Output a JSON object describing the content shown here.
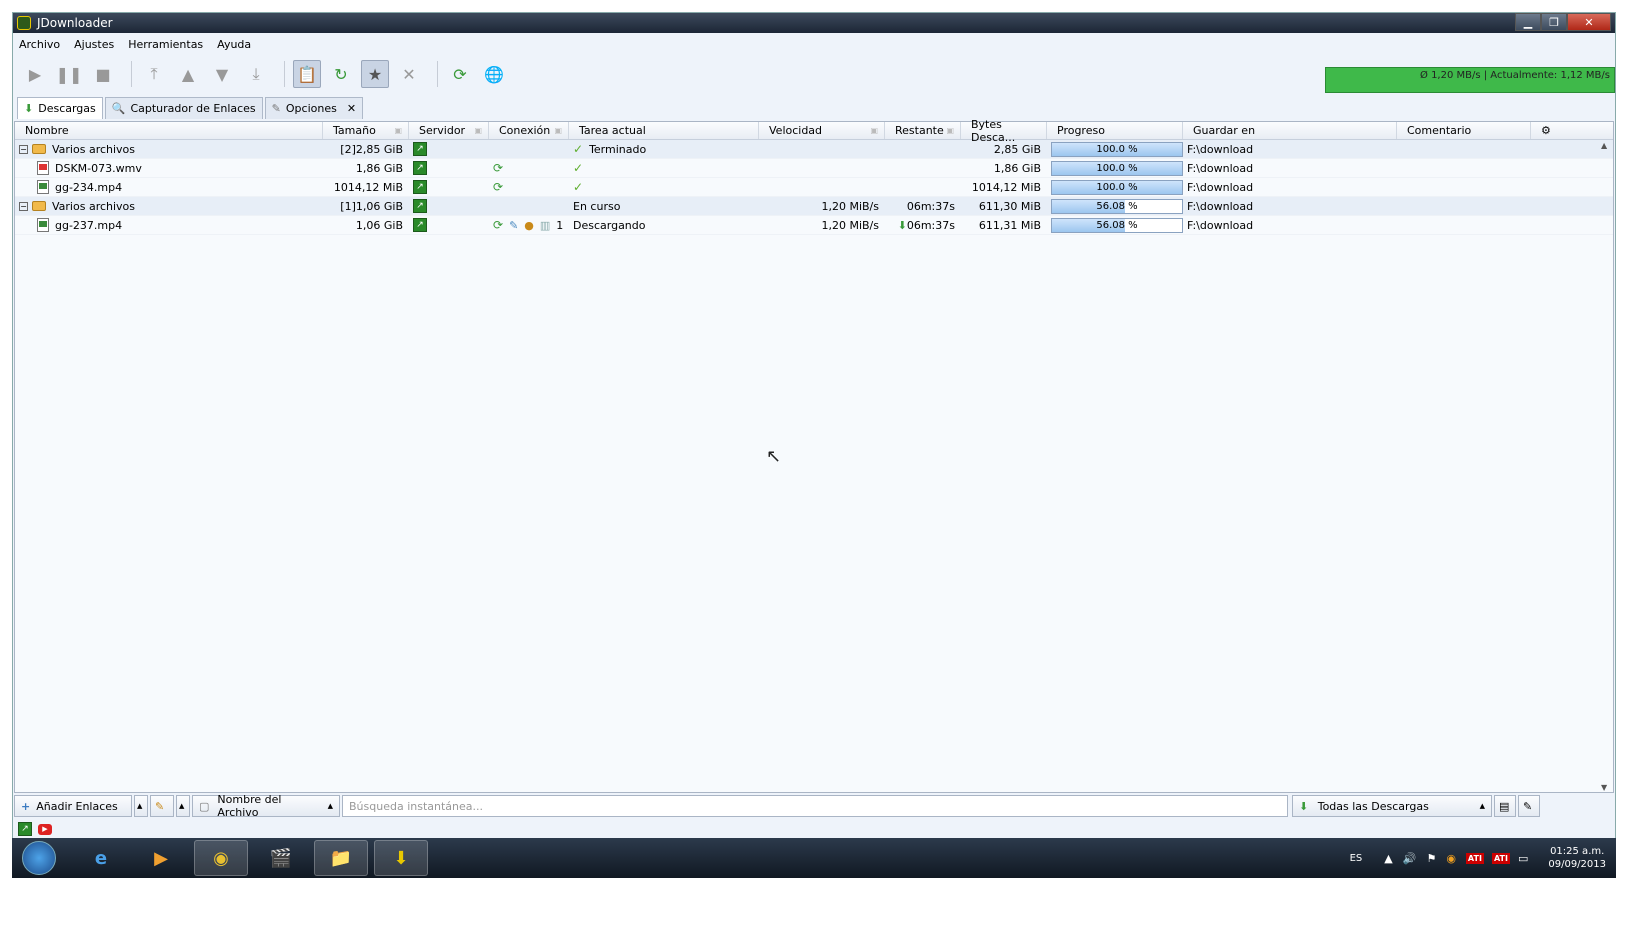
{
  "window": {
    "title": "JDownloader"
  },
  "menu": [
    "Archivo",
    "Ajustes",
    "Herramientas",
    "Ayuda"
  ],
  "speed": {
    "text": "Ø 1,20 MB/s | Actualmente: 1,12 MB/s"
  },
  "tabs": [
    {
      "label": "Descargas",
      "active": true
    },
    {
      "label": "Capturador de Enlaces",
      "active": false
    },
    {
      "label": "Opciones",
      "active": false
    }
  ],
  "columns": [
    "Nombre",
    "Tamaño",
    "Servidor",
    "Conexión",
    "Tarea actual",
    "Velocidad",
    "Restante",
    "Bytes Desca...",
    "Progreso",
    "Guardar en",
    "Comentario"
  ],
  "rows": [
    {
      "type": "package",
      "expander": "−",
      "name": "Varios archivos",
      "count": "[2]",
      "size": "2,85 GiB",
      "task": "Terminado",
      "task_icon": "check",
      "speed": "",
      "remaining": "",
      "bytes": "2,85 GiB",
      "progress": 100.0,
      "progress_text": "100.0 %",
      "save": "F:\\download"
    },
    {
      "type": "file",
      "ext": "wmv",
      "name": "DSKM-073.wmv",
      "size": "1,86 GiB",
      "conn": true,
      "task": "",
      "task_icon": "check",
      "speed": "",
      "remaining": "",
      "bytes": "1,86 GiB",
      "progress": 100.0,
      "progress_text": "100.0 %",
      "save": "F:\\download"
    },
    {
      "type": "file",
      "ext": "mp4",
      "name": "gg-234.mp4",
      "size": "1014,12 MiB",
      "conn": true,
      "task": "",
      "task_icon": "check",
      "speed": "",
      "remaining": "",
      "bytes": "1014,12 MiB",
      "progress": 100.0,
      "progress_text": "100.0 %",
      "save": "F:\\download"
    },
    {
      "type": "package",
      "expander": "−",
      "name": "Varios archivos",
      "count": "[1]",
      "size": "1,06 GiB",
      "task": "En curso",
      "task_icon": "",
      "speed": "1,20 MiB/s",
      "remaining": "06m:37s",
      "bytes": "611,30 MiB",
      "progress": 56.08,
      "progress_text": "56.08 %",
      "save": "F:\\download"
    },
    {
      "type": "file",
      "ext": "mp4",
      "name": "gg-237.mp4",
      "size": "1,06 GiB",
      "conn": true,
      "conn_count": "1",
      "task": "Descargando",
      "task_icon": "",
      "speed": "1,20 MiB/s",
      "remaining": "06m:37s",
      "bytes": "611,31 MiB",
      "progress": 56.08,
      "progress_text": "56.08 %",
      "save": "F:\\download"
    }
  ],
  "bottom": {
    "add_links": "Añadir Enlaces",
    "search_field": "Nombre del Archivo",
    "search_placeholder": "Búsqueda instantánea...",
    "filter": "Todas las Descargas"
  },
  "taskbar": {
    "lang": "ES",
    "time": "01:25 a.m.",
    "date": "09/09/2013"
  },
  "colors": {
    "accent": "#3fb94a",
    "progress": "#9cc6ef"
  }
}
